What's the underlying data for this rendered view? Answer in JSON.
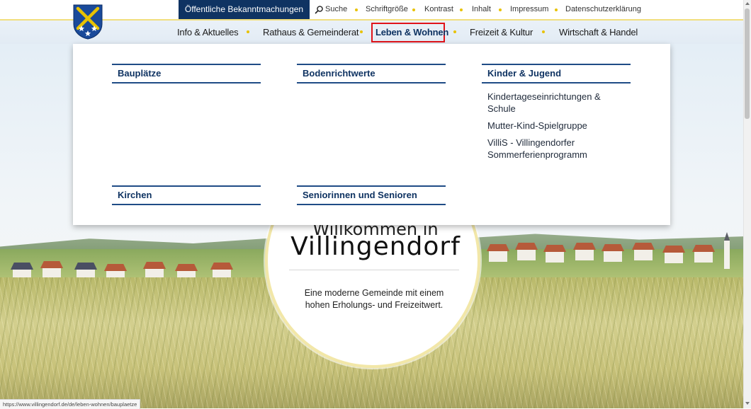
{
  "colors": {
    "brand_blue": "#0f3362",
    "accent_gold": "#e8c200",
    "active_outline": "#e0141a",
    "nav_background": "#e2ebf4"
  },
  "topbar": {
    "notice_button": "Öffentliche Bekanntmachungen",
    "search_icon": "search-icon",
    "links": {
      "search": "Suche",
      "font_size": "Schriftgröße",
      "contrast": "Kontrast",
      "contents": "Inhalt",
      "imprint": "Impressum",
      "privacy": "Datenschutzerklärung"
    }
  },
  "nav": {
    "items": [
      {
        "label": "Info & Aktuelles"
      },
      {
        "label": "Rathaus & Gemeinderat"
      },
      {
        "label": "Leben & Wohnen",
        "active": true
      },
      {
        "label": "Freizeit & Kultur"
      },
      {
        "label": "Wirtschaft & Handel"
      }
    ]
  },
  "dropdown": {
    "columns": [
      {
        "heading": "Bauplätze",
        "links": []
      },
      {
        "heading": "Bodenrichtwerte",
        "links": []
      },
      {
        "heading": "Kinder & Jugend",
        "links": [
          "Kindertageseinrichtungen & Schule",
          "Mutter-Kind-Spielgruppe",
          "VilliS - Villingendorfer Sommerferienprogramm"
        ]
      },
      {
        "heading": "Kirchen",
        "links": []
      },
      {
        "heading": "Seniorinnen und Senioren",
        "links": []
      }
    ]
  },
  "hero": {
    "welcome_pre": "Willkommen in",
    "title": "Villingendorf",
    "text": "Eine moderne Gemeinde mit einem hohen Erholungs- und Freizeitwert."
  },
  "statusbar": {
    "url": "https://www.villingendorf.de/de/leben-wohnen/bauplaetze"
  }
}
